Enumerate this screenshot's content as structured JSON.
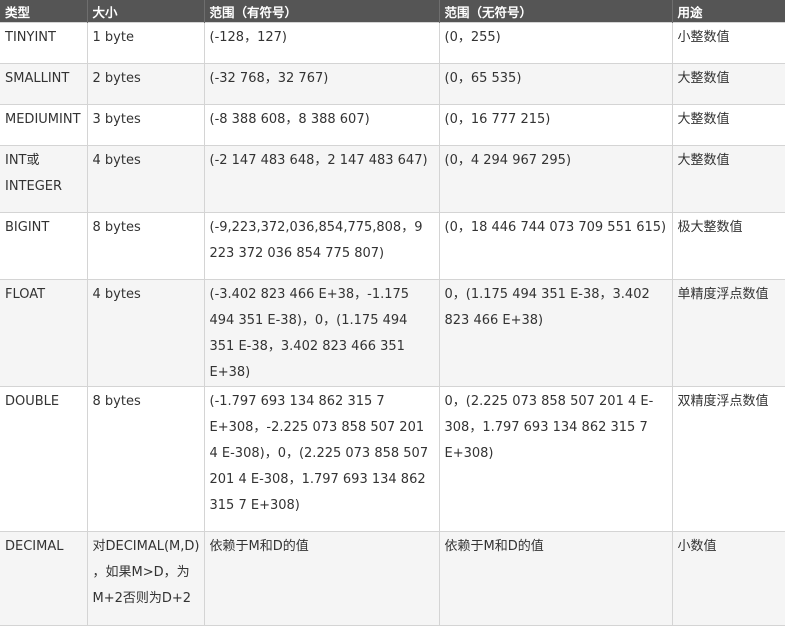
{
  "headers": [
    "类型",
    "大小",
    "范围（有符号）",
    "范围（无符号）",
    "用途"
  ],
  "rows": [
    {
      "type": "TINYINT",
      "size": "1 byte",
      "signed": "(-128，127)",
      "unsigned": "(0，255)",
      "use": "小整数值"
    },
    {
      "type": "SMALLINT",
      "size": "2 bytes",
      "signed": "(-32 768，32 767)",
      "unsigned": "(0，65 535)",
      "use": "大整数值"
    },
    {
      "type": "MEDIUMINT",
      "size": "3 bytes",
      "signed": "(-8 388 608，8 388 607)",
      "unsigned": "(0，16 777 215)",
      "use": "大整数值"
    },
    {
      "type": "INT或INTEGER",
      "size": "4 bytes",
      "signed": "(-2 147 483 648，2 147 483 647)",
      "unsigned": "(0，4 294 967 295)",
      "use": "大整数值"
    },
    {
      "type": "BIGINT",
      "size": "8 bytes",
      "signed": "(-9,223,372,036,854,775,808，9 223 372 036 854 775 807)",
      "unsigned": "(0，18 446 744 073 709 551 615)",
      "use": "极大整数值"
    },
    {
      "type": "FLOAT",
      "size": "4 bytes",
      "signed": "(-3.402 823 466 E+38，-1.175 494 351 E-38)，0，(1.175 494 351 E-38，3.402 823 466 351 E+38)",
      "unsigned": "0，(1.175 494 351 E-38，3.402 823 466 E+38)",
      "use": "单精度浮点数值"
    },
    {
      "type": "DOUBLE",
      "size": "8 bytes",
      "signed": "(-1.797 693 134 862 315 7 E+308，-2.225 073 858 507 201 4 E-308)，0，(2.225 073 858 507 201 4 E-308，1.797 693 134 862 315 7 E+308)",
      "unsigned": "0，(2.225 073 858 507 201 4 E-308，1.797 693 134 862 315 7 E+308)",
      "use": "双精度浮点数值"
    },
    {
      "type": "DECIMAL",
      "size": "对DECIMAL(M,D) ，如果M>D，为M+2否则为D+2",
      "signed": "依赖于M和D的值",
      "unsigned": "依赖于M和D的值",
      "use": "小数值"
    }
  ]
}
